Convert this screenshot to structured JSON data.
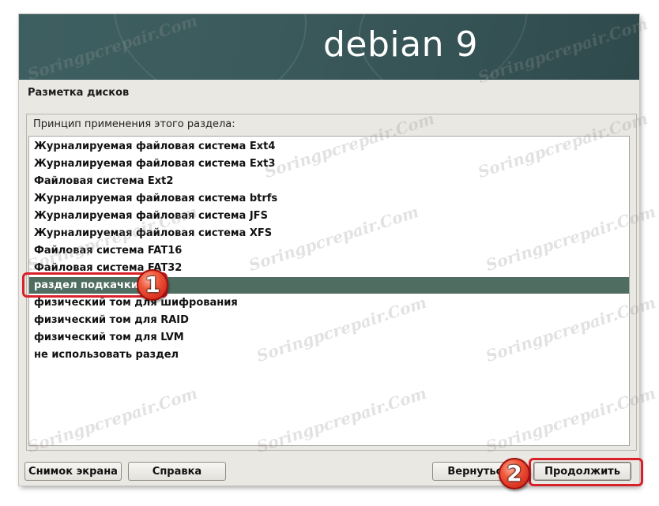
{
  "banner": {
    "title": "debian 9"
  },
  "page": {
    "title": "Разметка дисков"
  },
  "panel": {
    "question": "Принцип применения этого раздела:"
  },
  "options": [
    "Журналируемая файловая система Ext4",
    "Журналируемая файловая система Ext3",
    "Файловая система Ext2",
    "Журналируемая файловая система btrfs",
    "Журналируемая файловая система JFS",
    "Журналируемая файловая система XFS",
    "Файловая система FAT16",
    "Файловая система FAT32",
    "раздел подкачки",
    "физический том для шифрования",
    "физический том для RAID",
    "физический том для LVM",
    "не использовать раздел"
  ],
  "selected_index": 8,
  "buttons": {
    "screenshot": "Снимок экрана",
    "help": "Справка",
    "back": "Вернуться",
    "continue": "Продолжить"
  },
  "annotations": {
    "badge1": "1",
    "badge2": "2"
  },
  "watermark": {
    "text": "Soringpcrepair.Com"
  },
  "colors": {
    "banner": "#3e5f61",
    "selection": "#4f6e61",
    "callout": "#d8212b"
  }
}
